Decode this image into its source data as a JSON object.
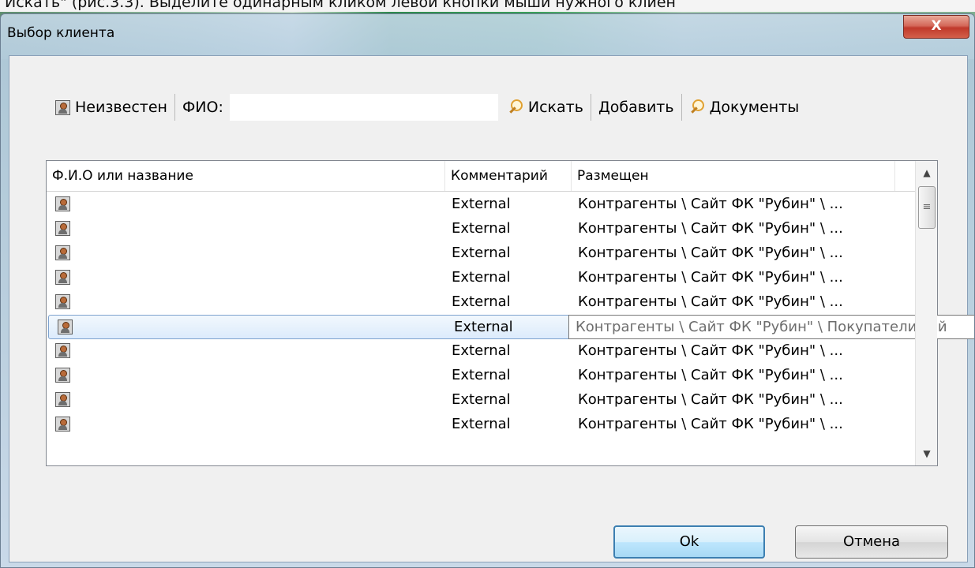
{
  "background": {
    "doc_text": "Искать\" (рис.3.3). Выделите одинарным кликом левой кнопки мыши нужного клиен"
  },
  "window": {
    "title": "Выбор клиента",
    "close_label": "X"
  },
  "toolbar": {
    "unknown_label": "Неизвестен",
    "fio_label": "ФИО:",
    "fio_value": "",
    "search_label": "Искать",
    "add_label": "Добавить",
    "documents_label": "Документы"
  },
  "list": {
    "columns": [
      "Ф.И.О или название",
      "Комментарий",
      "Размещен"
    ],
    "rows": [
      {
        "name": "",
        "comment": "External",
        "location": "Контрагенты \\ Сайт ФК \"Рубин\" \\ ..."
      },
      {
        "name": "",
        "comment": "External",
        "location": "Контрагенты \\ Сайт ФК \"Рубин\" \\ ..."
      },
      {
        "name": "",
        "comment": "External",
        "location": "Контрагенты \\ Сайт ФК \"Рубин\" \\ ..."
      },
      {
        "name": "",
        "comment": "External",
        "location": "Контрагенты \\ Сайт ФК \"Рубин\" \\ ..."
      },
      {
        "name": "",
        "comment": "External",
        "location": "Контрагенты \\ Сайт ФК \"Рубин\" \\ ..."
      },
      {
        "name": "",
        "comment": "External",
        "location": "Контрагенты \\ Сайт ФК \"Рубин\" \\ ..."
      },
      {
        "name": "",
        "comment": "External",
        "location": "Контрагенты \\ Сайт ФК \"Рубин\" \\ ..."
      },
      {
        "name": "",
        "comment": "External",
        "location": "Контрагенты \\ Сайт ФК \"Рубин\" \\ ..."
      },
      {
        "name": "",
        "comment": "External",
        "location": "Контрагенты \\ Сайт ФК \"Рубин\" \\ ..."
      },
      {
        "name": "",
        "comment": "External",
        "location": "Контрагенты \\ Сайт ФК \"Рубин\" \\ ..."
      }
    ],
    "selected_row": 5,
    "tooltip": "Контрагенты \\ Сайт ФК \"Рубин\" \\ Покупатели сай"
  },
  "buttons": {
    "ok_label": "Ok",
    "cancel_label": "Отмена"
  },
  "colors": {
    "selection_border": "#7da2ce",
    "ok_border": "#3c7fb1",
    "close_red": "#c0392b"
  },
  "icons": {
    "unknown": "person-icon",
    "search": "search-icon",
    "documents": "search-icon",
    "row": "person-icon"
  }
}
